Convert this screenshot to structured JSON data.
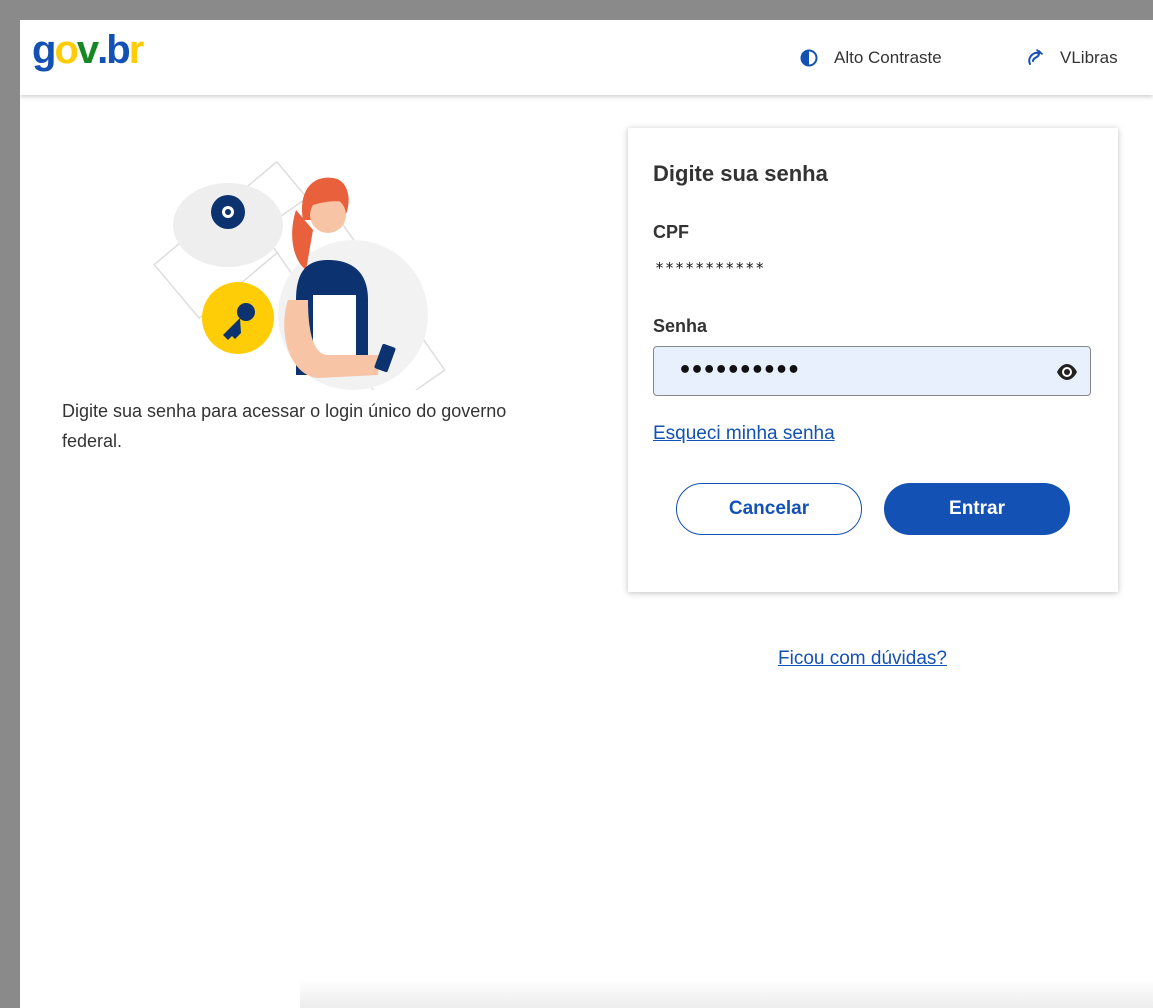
{
  "header": {
    "logo": {
      "g": "g",
      "o": "o",
      "v": "v",
      "dot": ".",
      "b": "b",
      "r": "r"
    },
    "logo_colors": {
      "g": "#1351b4",
      "o": "#ffcd07",
      "v": "#168821",
      "dot": "#1351b4",
      "b": "#1351b4",
      "r": "#ffcd07"
    },
    "contrast_label": "Alto Contraste",
    "contrast_icon": "contrast-icon",
    "vlibras_label": "VLibras",
    "vlibras_icon": "sign-language-icon"
  },
  "intro": {
    "text": "Digite sua senha para acessar o login único do governo federal."
  },
  "card": {
    "title": "Digite sua senha",
    "cpf_label": "CPF",
    "cpf_value": "***********",
    "password_label": "Senha",
    "password_value": "••••••••••",
    "show_password_icon": "eye-icon",
    "forgot_link": "Esqueci minha senha",
    "cancel_button": "Cancelar",
    "enter_button": "Entrar"
  },
  "help_link": "Ficou com dúvidas?",
  "colors": {
    "primary": "#1351b4",
    "input_bg": "#e8f0fe",
    "text": "#333333",
    "accent_yellow": "#ffcd07"
  }
}
